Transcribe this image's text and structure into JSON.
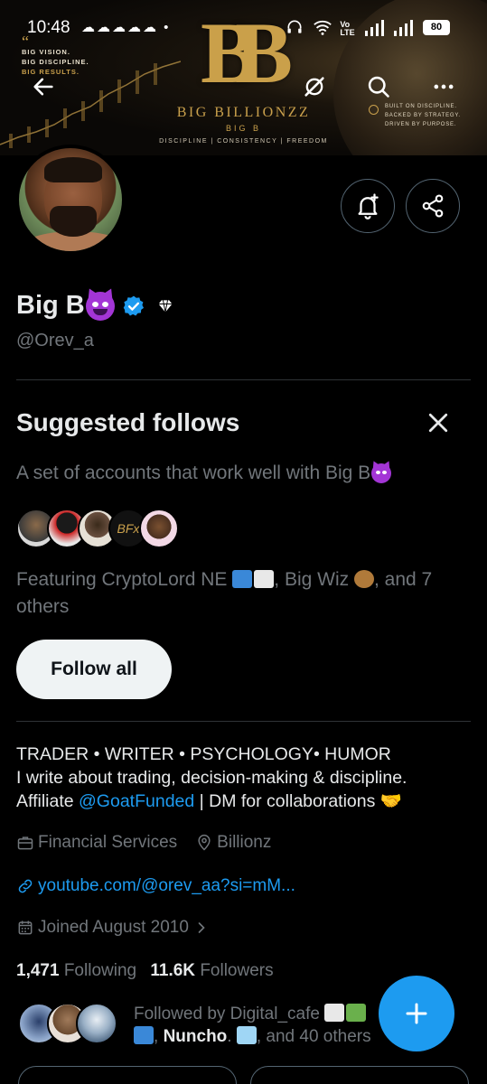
{
  "status_bar": {
    "time": "10:48",
    "notification_icons": "☁☁☁☁☁ •",
    "network": "Vo LTE",
    "battery": "80"
  },
  "banner": {
    "logo_letters": "BB",
    "brand_name": "BIG BILLIONZZ",
    "brand_sub": "BIG B",
    "tagline": "DISCIPLINE  |  CONSISTENCY  |  FREEDOM",
    "left_text": [
      "BIG VISION.",
      "BIG DISCIPLINE.",
      "BIG RESULTS."
    ],
    "right_text": [
      "BUILT ON DISCIPLINE.",
      "BACKED BY STRATEGY.",
      "DRIVEN BY PURPOSE."
    ]
  },
  "profile": {
    "display_name": "Big B",
    "handle": "@Orev_a"
  },
  "suggested": {
    "title": "Suggested follows",
    "description": "A set of accounts that work well with Big B",
    "featuring_prefix": "Featuring CryptoLord NE ",
    "featuring_mid": ", Big Wiz ",
    "featuring_suffix": ", and 7 others",
    "follow_all_label": "Follow all"
  },
  "bio": {
    "line1": "TRADER • WRITER • PSYCHOLOGY• HUMOR",
    "line2": "I write about trading, decision-making & discipline.",
    "line3_prefix": "Affiliate ",
    "line3_link": "@GoatFunded",
    "line3_suffix": " | DM for collaborations 🤝"
  },
  "meta": {
    "category": "Financial Services",
    "location": "Billionz",
    "website": "youtube.com/@orev_aa?si=mM...",
    "joined": "Joined August 2010"
  },
  "counts": {
    "following_count": "1,471",
    "following_label": "Following",
    "followers_count": "11.6K",
    "followers_label": "Followers"
  },
  "followed_by": {
    "prefix": "Followed by Digital_cafe ",
    "name2": "Nuncho",
    "suffix": ", and 40 others"
  },
  "colors": {
    "accent": "#1d9bf0",
    "background": "#000000",
    "muted": "#71767b",
    "gold": "#c9a04c"
  }
}
